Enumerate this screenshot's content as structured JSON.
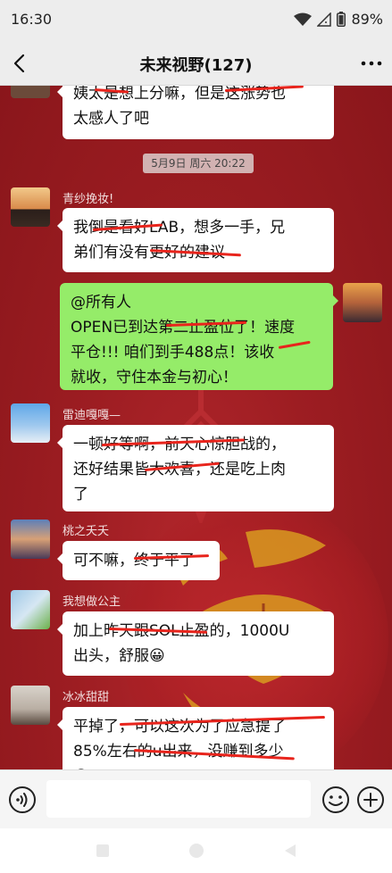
{
  "status": {
    "time": "16:30",
    "battery": "89%"
  },
  "header": {
    "title": "未来视野(127)"
  },
  "time_divider": "5月9日 周六 20:22",
  "messages": {
    "m0": {
      "lines": [
        "姨太是想上分嘛，但是这涨势也",
        "太感人了吧"
      ]
    },
    "m1": {
      "sender": "青纱挽妆!",
      "lines": [
        "我倒是看好LAB，想多一手，兄",
        "弟们有没有更好的建议"
      ]
    },
    "m2": {
      "lines": [
        "@所有人",
        "OPEN已到达第二止盈位了！速度",
        "平仓!!! 咱们到手488点！该收",
        "就收，守住本金与初心！"
      ]
    },
    "m3": {
      "sender": "雷迪嘎嘎—",
      "lines": [
        "一顿好等啊，前天心惊胆战的，",
        "还好结果皆大欢喜，还是吃上肉",
        "了"
      ]
    },
    "m4": {
      "sender": "桃之夭夭",
      "lines": [
        "可不嘛，终于平了"
      ]
    },
    "m5": {
      "sender": "我想做公主",
      "lines": [
        "加上昨天跟SOL止盈的，1000U",
        "出头，舒服😀"
      ]
    },
    "m6": {
      "sender": "冰冰甜甜",
      "lines": [
        "平掉了，可以这次为了应急提了",
        "85%左右的u出来，没赚到多少",
        "😀"
      ]
    }
  },
  "icons": {
    "back": "back-arrow-icon",
    "more": "more-dots-icon",
    "voice": "voice-icon",
    "emoji": "emoji-icon",
    "plus": "plus-icon",
    "wifi": "wifi-icon",
    "signal": "signal-icon",
    "battery": "battery-icon"
  },
  "colors": {
    "chat_bg": "#9d1d22",
    "bubble_self": "#95ec69",
    "strike": "#e8241c"
  }
}
